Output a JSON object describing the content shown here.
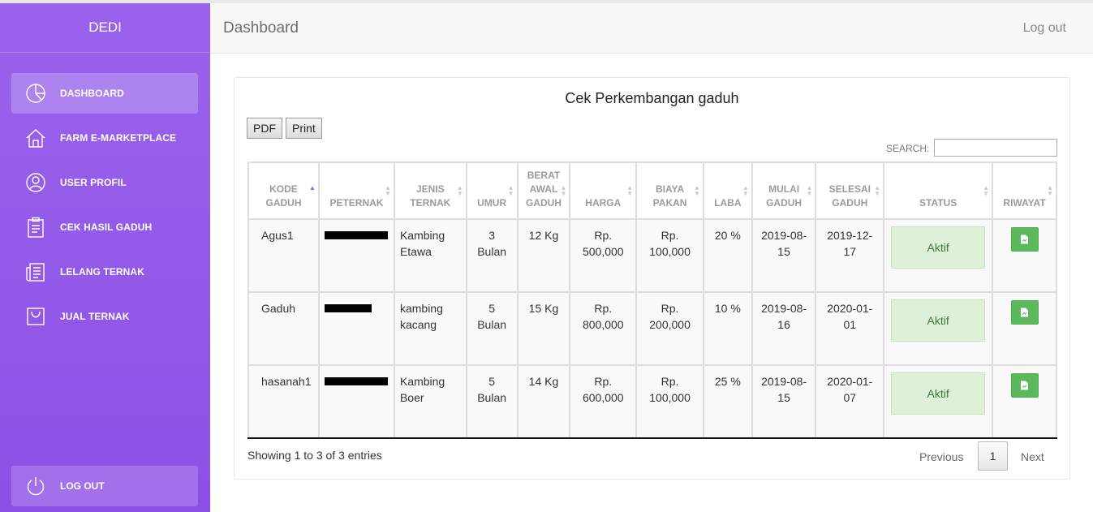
{
  "sidebar": {
    "brand": "DEDI",
    "items": [
      {
        "label": "DASHBOARD",
        "icon": "pie-chart-icon"
      },
      {
        "label": "FARM E-MARKETPLACE",
        "icon": "home-icon"
      },
      {
        "label": "USER PROFIL",
        "icon": "user-icon"
      },
      {
        "label": "CEK HASIL GADUH",
        "icon": "clipboard-icon"
      },
      {
        "label": "LELANG TERNAK",
        "icon": "newspaper-icon"
      },
      {
        "label": "JUAL TERNAK",
        "icon": "bag-icon"
      }
    ],
    "logout": "LOG OUT"
  },
  "header": {
    "title": "Dashboard",
    "logout": "Log out"
  },
  "card": {
    "title": "Cek Perkembangan gaduh",
    "pdf_label": "PDF",
    "print_label": "Print",
    "search_label": "SEARCH:",
    "search_value": ""
  },
  "table": {
    "columns": [
      {
        "lines": [
          "KODE",
          "GADUH"
        ],
        "sort": "asc"
      },
      {
        "lines": [
          "PETERNAK"
        ],
        "sort": "none"
      },
      {
        "lines": [
          "JENIS",
          "TERNAK"
        ],
        "sort": "none"
      },
      {
        "lines": [
          "UMUR"
        ],
        "sort": "none"
      },
      {
        "lines": [
          "BERAT",
          "AWAL",
          "GADUH"
        ],
        "sort": "none"
      },
      {
        "lines": [
          "HARGA"
        ],
        "sort": "none"
      },
      {
        "lines": [
          "BIAYA",
          "PAKAN"
        ],
        "sort": "none"
      },
      {
        "lines": [
          "LABA"
        ],
        "sort": "none"
      },
      {
        "lines": [
          "MULAI",
          "GADUH"
        ],
        "sort": "none"
      },
      {
        "lines": [
          "SELESAI",
          "GADUH"
        ],
        "sort": "none"
      },
      {
        "lines": [
          "STATUS"
        ],
        "sort": "none"
      },
      {
        "lines": [
          "RIWAYAT"
        ],
        "sort": "none"
      }
    ],
    "rows": [
      {
        "kode": "Agus1",
        "jenis": [
          "Kambing",
          "Etawa"
        ],
        "umur": [
          "3",
          "Bulan"
        ],
        "berat": "12 Kg",
        "harga": [
          "Rp.",
          "500,000"
        ],
        "biaya": [
          "Rp.",
          "100,000"
        ],
        "laba": "20 %",
        "mulai": [
          "2019-08-",
          "15"
        ],
        "selesai": [
          "2019-12-",
          "17"
        ],
        "status": "Aktif"
      },
      {
        "kode": "Gaduh",
        "jenis": [
          "kambing",
          "kacang"
        ],
        "umur": [
          "5",
          "Bulan"
        ],
        "berat": "15 Kg",
        "harga": [
          "Rp.",
          "800,000"
        ],
        "biaya": [
          "Rp.",
          "200,000"
        ],
        "laba": "10 %",
        "mulai": [
          "2019-08-",
          "16"
        ],
        "selesai": [
          "2020-01-",
          "01"
        ],
        "status": "Aktif"
      },
      {
        "kode": "hasanah1",
        "jenis": [
          "Kambing",
          "Boer"
        ],
        "umur": [
          "5",
          "Bulan"
        ],
        "berat": "14 Kg",
        "harga": [
          "Rp.",
          "600,000"
        ],
        "biaya": [
          "Rp.",
          "100,000"
        ],
        "laba": "25 %",
        "mulai": [
          "2019-08-",
          "15"
        ],
        "selesai": [
          "2020-01-",
          "07"
        ],
        "status": "Aktif"
      }
    ]
  },
  "footer": {
    "info": "Showing 1 to 3 of 3 entries",
    "previous": "Previous",
    "page": "1",
    "next": "Next"
  },
  "colors": {
    "sidebar": "#9a63ec",
    "status_bg": "#dff0d8",
    "status_text": "#3c763d",
    "riwayat_button": "#5cb85c"
  }
}
